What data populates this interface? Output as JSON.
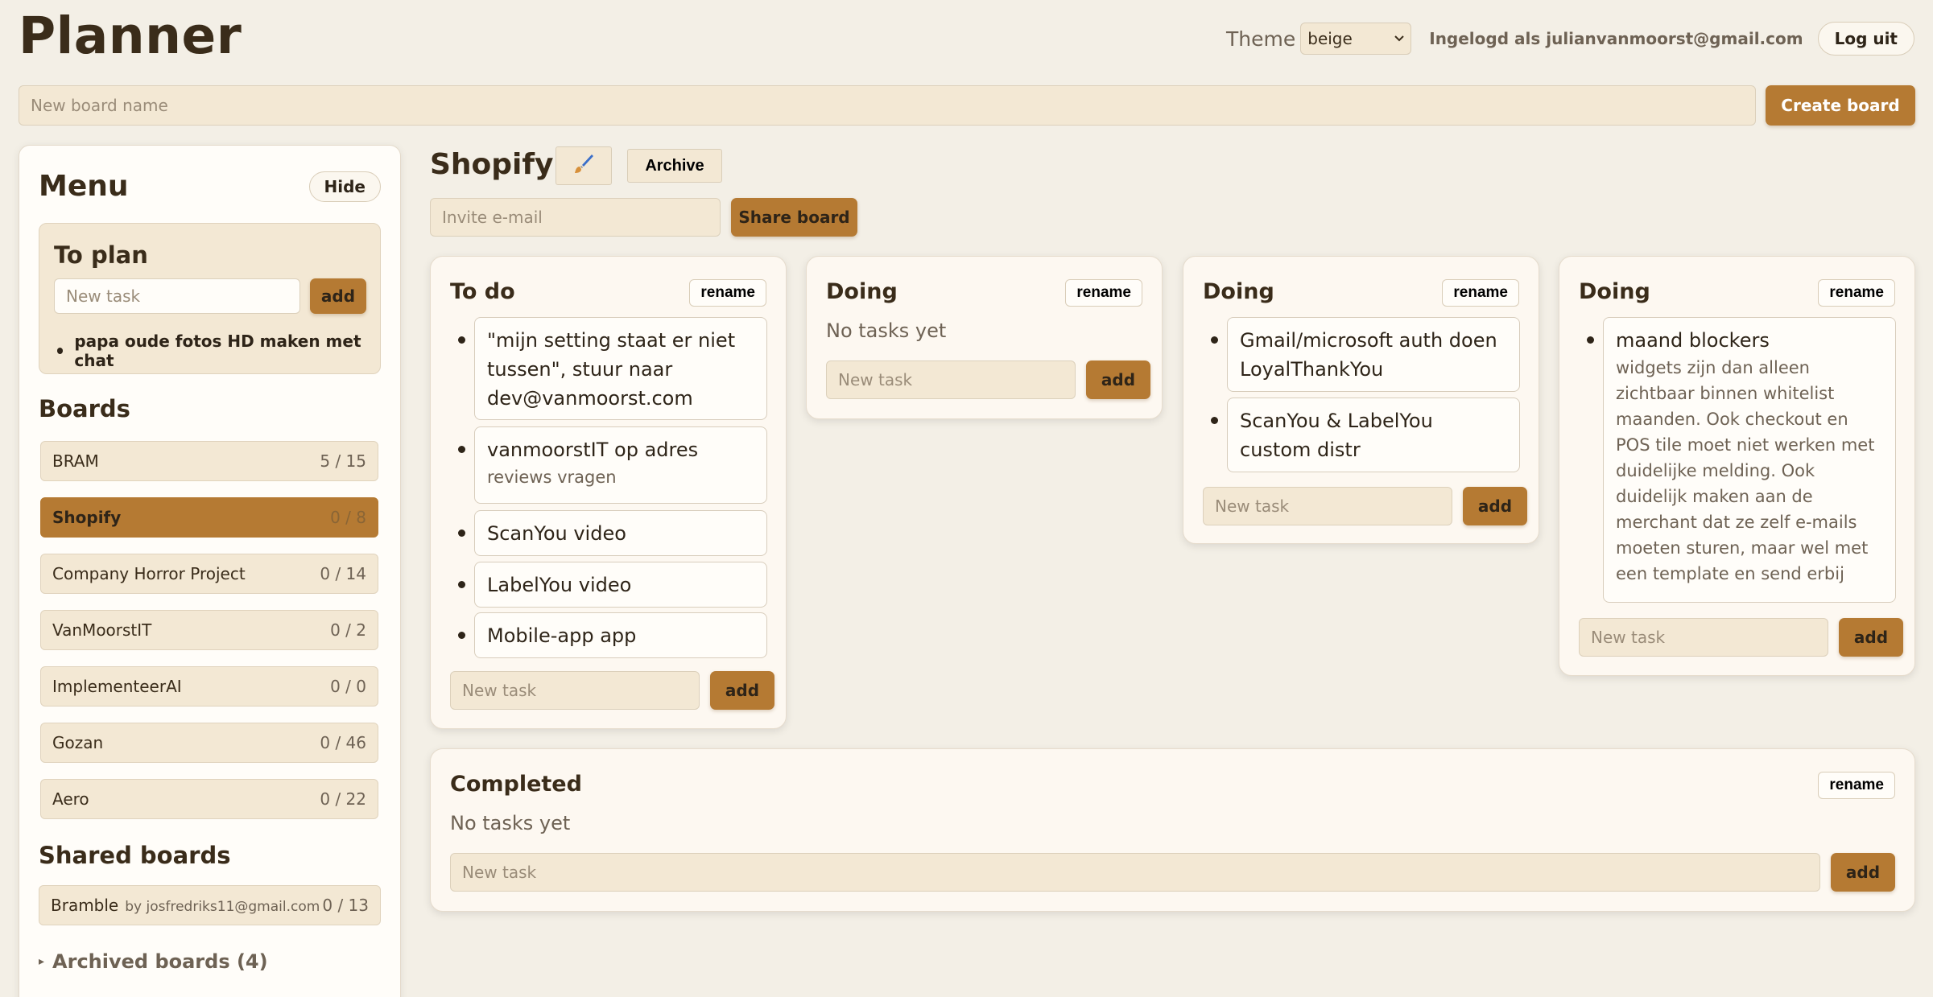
{
  "app": {
    "title": "Planner"
  },
  "topbar": {
    "theme_label": "Theme",
    "theme_value": "beige",
    "user_label": "Ingelogd als julianvanmoorst@gmail.com",
    "logout_label": "Log uit"
  },
  "newboard": {
    "placeholder": "New board name",
    "create_label": "Create board"
  },
  "sidebar": {
    "title": "Menu",
    "hide_label": "Hide",
    "toplan": {
      "title": "To plan",
      "input_placeholder": "New task",
      "add_label": "add",
      "items": [
        "papa oude fotos HD maken met chat"
      ]
    },
    "boards_title": "Boards",
    "boards": [
      {
        "name": "BRAM",
        "count": "5 / 15"
      },
      {
        "name": "Shopify",
        "count": "0 / 8",
        "active": true
      },
      {
        "name": "Company Horror Project",
        "count": "0 / 14"
      },
      {
        "name": "VanMoorstIT",
        "count": "0 / 2"
      },
      {
        "name": "ImplementeerAI",
        "count": "0 / 0"
      },
      {
        "name": "Gozan",
        "count": "0 / 46"
      },
      {
        "name": "Aero",
        "count": "0 / 22"
      }
    ],
    "shared_title": "Shared boards",
    "shared": [
      {
        "name": "Bramble",
        "by": "by josfredriks11@gmail.com",
        "count": "0 / 13"
      }
    ],
    "archived_label": "Archived boards (4)"
  },
  "board": {
    "title": "Shopify",
    "archive_label": "Archive",
    "invite_placeholder": "Invite e-mail",
    "share_label": "Share board",
    "rename_label": "rename",
    "new_task_placeholder": "New task",
    "add_label": "add",
    "no_tasks": "No tasks yet",
    "columns": [
      {
        "title": "To do",
        "tasks": [
          {
            "title": "\"mijn setting staat er niet tussen\", stuur naar dev@vanmoorst.com"
          },
          {
            "title": "vanmoorstIT op adres",
            "desc": "reviews vragen"
          },
          {
            "title": "ScanYou video"
          },
          {
            "title": "LabelYou video"
          },
          {
            "title": "Mobile-app app"
          }
        ]
      },
      {
        "title": "Doing",
        "tasks": []
      },
      {
        "title": "Doing",
        "tasks": [
          {
            "title": "Gmail/microsoft auth doen LoyalThankYou"
          },
          {
            "title": "ScanYou & LabelYou custom distr"
          }
        ]
      },
      {
        "title": "Doing",
        "tasks": [
          {
            "title": "maand blockers",
            "desc": "widgets zijn dan alleen zichtbaar binnen whitelist maanden. Ook checkout en POS tile moet niet werken met duidelijke melding. Ook duidelijk maken aan de merchant dat ze zelf e-mails moeten sturen, maar wel met een template en send erbij"
          }
        ]
      }
    ],
    "completed": {
      "title": "Completed"
    }
  },
  "colors": {
    "accent": "#b57a33",
    "background": "#f3efe6",
    "surface": "#fffdf9"
  },
  "icons": {
    "palette": "paintbrush-icon",
    "select": "chevron-down-icon",
    "archived": "triangle-right-icon"
  }
}
